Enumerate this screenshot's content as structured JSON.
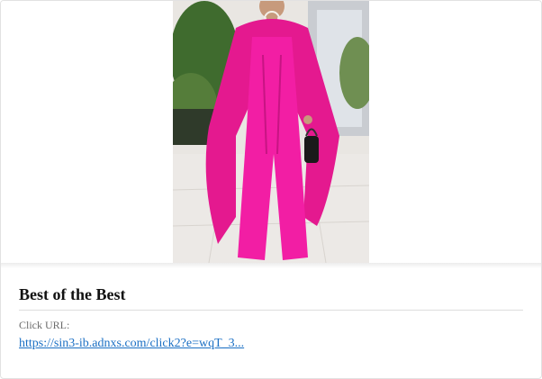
{
  "ad": {
    "image": {
      "subject": "woman in magenta cape jumpsuit"
    },
    "title": "Best of the Best",
    "click_label": "Click URL:",
    "click_url_text": "https://sin3-ib.adnxs.com/click2?e=wqT_3..."
  },
  "colors": {
    "dress": "#ee1aa0",
    "link": "#1a6fc4",
    "title": "#111111"
  }
}
